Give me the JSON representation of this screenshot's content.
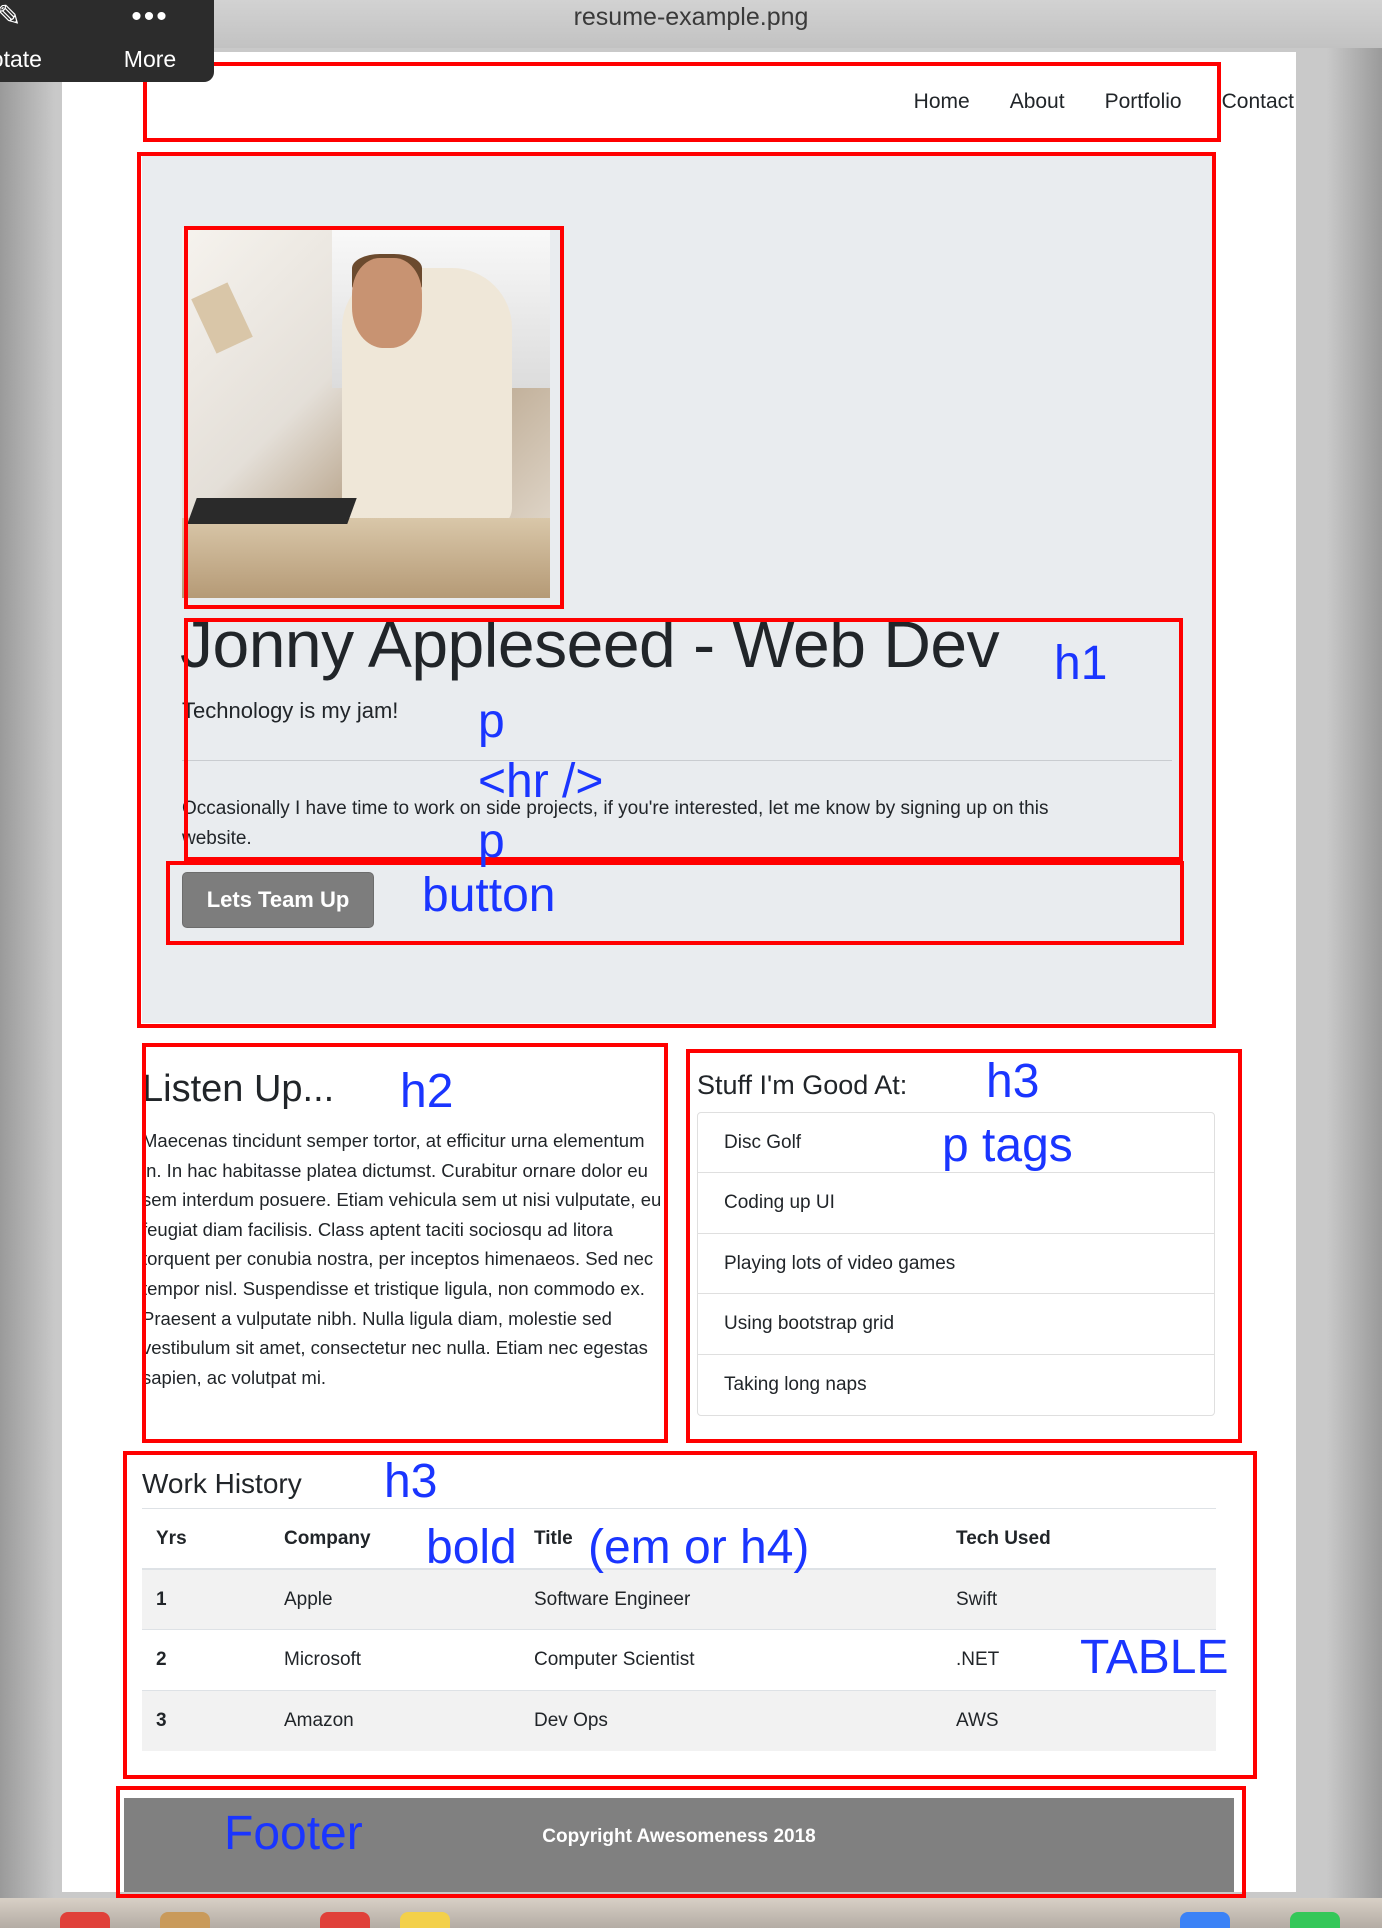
{
  "window": {
    "title": "resume-example.png"
  },
  "toolbar": {
    "annotate_label": "notate",
    "more_label": "More",
    "more_icon": "•••"
  },
  "nav": {
    "items": [
      "Home",
      "About",
      "Portfolio",
      "Contact"
    ]
  },
  "jumbotron": {
    "title": "Jonny Appleseed - Web Dev",
    "lead": "Technology is my jam!",
    "text": "Occasionally I have time to work on side projects, if you're interested, let me know by signing up on this website.",
    "button_label": "Lets Team Up"
  },
  "about": {
    "heading": "Listen Up...",
    "text": "Maecenas tincidunt semper tortor, at efficitur urna elementum in. In hac habitasse platea dictumst. Curabitur ornare dolor eu sem interdum posuere. Etiam vehicula sem ut nisi vulputate, eu feugiat diam facilisis. Class aptent taciti sociosqu ad litora torquent per conubia nostra, per inceptos himenaeos. Sed nec tempor nisl. Suspendisse et tristique ligula, non commodo ex. Praesent a vulputate nibh. Nulla ligula diam, molestie sed vestibulum sit amet, consectetur nec nulla. Etiam nec egestas sapien, ac volutpat mi."
  },
  "skills": {
    "heading": "Stuff I'm Good At:",
    "items": [
      "Disc Golf",
      "Coding up UI",
      "Playing lots of video games",
      "Using bootstrap grid",
      "Taking long naps"
    ]
  },
  "work": {
    "heading": "Work History",
    "columns": [
      "Yrs",
      "Company",
      "Title",
      "Tech Used"
    ],
    "rows": [
      [
        "1",
        "Apple",
        "Software Engineer",
        "Swift"
      ],
      [
        "2",
        "Microsoft",
        "Computer Scientist",
        ".NET"
      ],
      [
        "3",
        "Amazon",
        "Dev Ops",
        "AWS"
      ]
    ]
  },
  "footer": {
    "text": "Copyright Awesomeness 2018"
  },
  "annotations": {
    "h1": "h1",
    "p1": "p",
    "hr": "<hr />",
    "p2": "p",
    "button": "button",
    "h2": "h2",
    "h3_skills": "h3",
    "p_tags": "p tags",
    "h3_work": "h3",
    "bold": "bold",
    "em_or_h4": "(em or h4)",
    "table": "TABLE",
    "footer": "Footer"
  },
  "colors": {
    "annotation_box": "#ff0000",
    "annotation_text": "#1a35ff",
    "jumbotron_bg": "#e9ecef",
    "footer_bg": "#808080",
    "button_bg": "#7d7d7d"
  }
}
